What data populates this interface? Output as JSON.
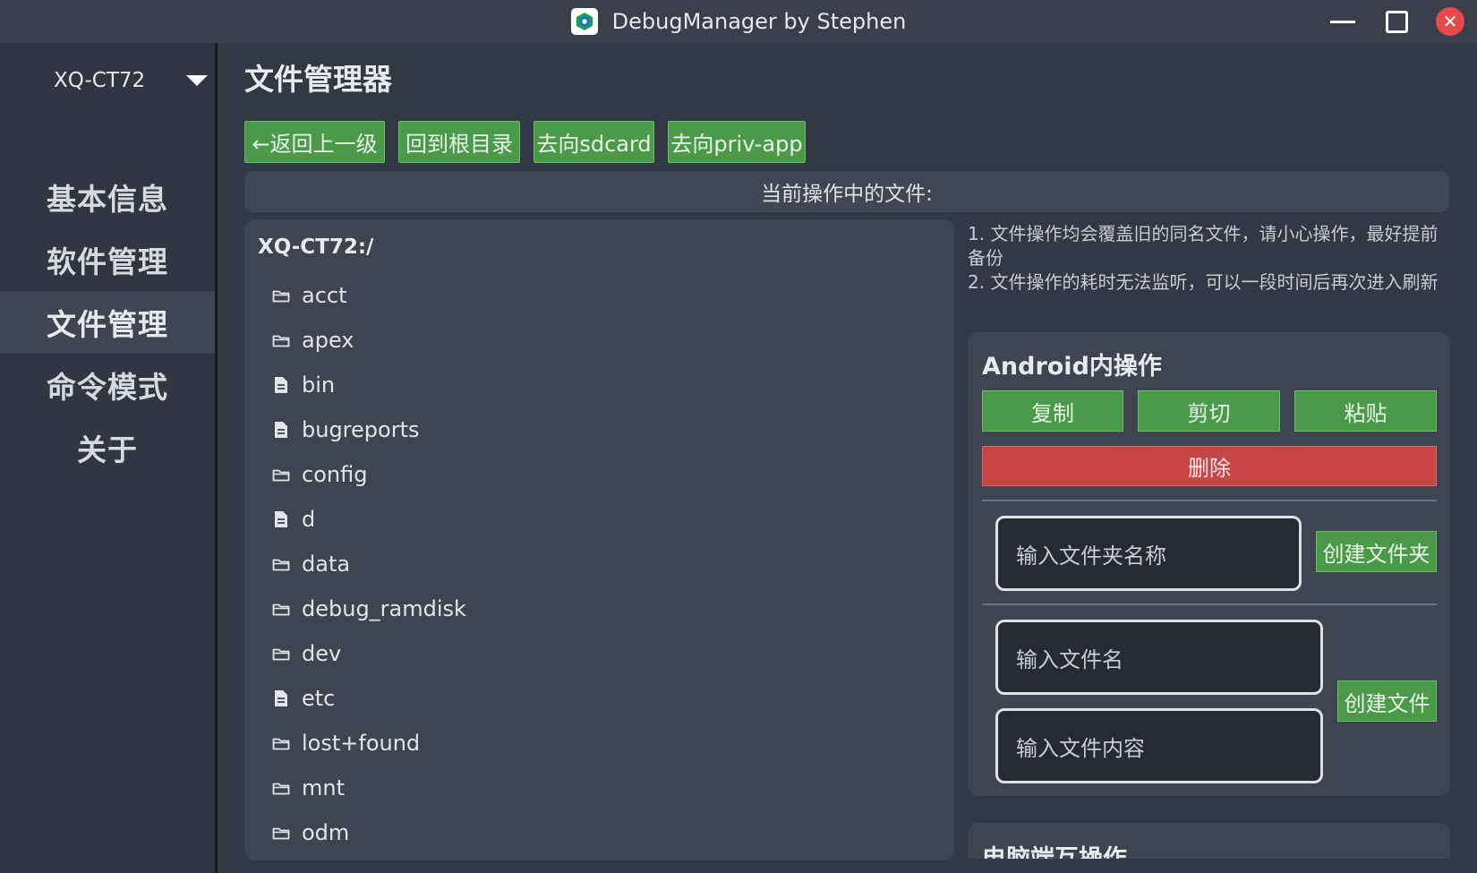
{
  "window": {
    "title": "DebugManager by Stephen"
  },
  "sidebar": {
    "device": "XQ-CT72",
    "items": [
      {
        "label": "基本信息",
        "active": false
      },
      {
        "label": "软件管理",
        "active": false
      },
      {
        "label": "文件管理",
        "active": true
      },
      {
        "label": "命令模式",
        "active": false
      },
      {
        "label": "关于",
        "active": false
      }
    ]
  },
  "main": {
    "title": "文件管理器",
    "toolbar": {
      "back_label": "←返回上一级",
      "root_label": "回到根目录",
      "sdcard_label": "去向sdcard",
      "privapp_label": "去向priv-app"
    },
    "current_file_label": "当前操作中的文件:",
    "file_panel": {
      "path": "XQ-CT72:/",
      "items": [
        {
          "name": "acct",
          "icon": "folder-icon"
        },
        {
          "name": "apex",
          "icon": "folder-icon"
        },
        {
          "name": "bin",
          "icon": "file-icon"
        },
        {
          "name": "bugreports",
          "icon": "file-icon"
        },
        {
          "name": "config",
          "icon": "folder-icon"
        },
        {
          "name": "d",
          "icon": "file-icon"
        },
        {
          "name": "data",
          "icon": "folder-icon"
        },
        {
          "name": "debug_ramdisk",
          "icon": "folder-icon"
        },
        {
          "name": "dev",
          "icon": "folder-icon"
        },
        {
          "name": "etc",
          "icon": "file-icon"
        },
        {
          "name": "lost+found",
          "icon": "folder-icon"
        },
        {
          "name": "mnt",
          "icon": "folder-icon"
        },
        {
          "name": "odm",
          "icon": "folder-icon"
        }
      ]
    },
    "notes": {
      "line1": "1. 文件操作均会覆盖旧的同名文件，请小心操作，最好提前备份",
      "line2": "2. 文件操作的耗时无法监听，可以一段时间后再次进入刷新"
    },
    "android_panel": {
      "title": "Android内操作",
      "copy_label": "复制",
      "cut_label": "剪切",
      "paste_label": "粘贴",
      "delete_label": "删除",
      "folder_name_placeholder": "输入文件夹名称",
      "create_folder_label": "创建文件夹",
      "file_name_placeholder": "输入文件名",
      "file_content_placeholder": "输入文件内容",
      "create_file_label": "创建文件"
    },
    "pc_panel": {
      "title": "电脑端互操作"
    }
  },
  "colors": {
    "background": "#323844",
    "panel": "#3f4451",
    "green_button": "#4a9a4a",
    "red_button": "#c74545",
    "close_button": "#e5484d"
  }
}
